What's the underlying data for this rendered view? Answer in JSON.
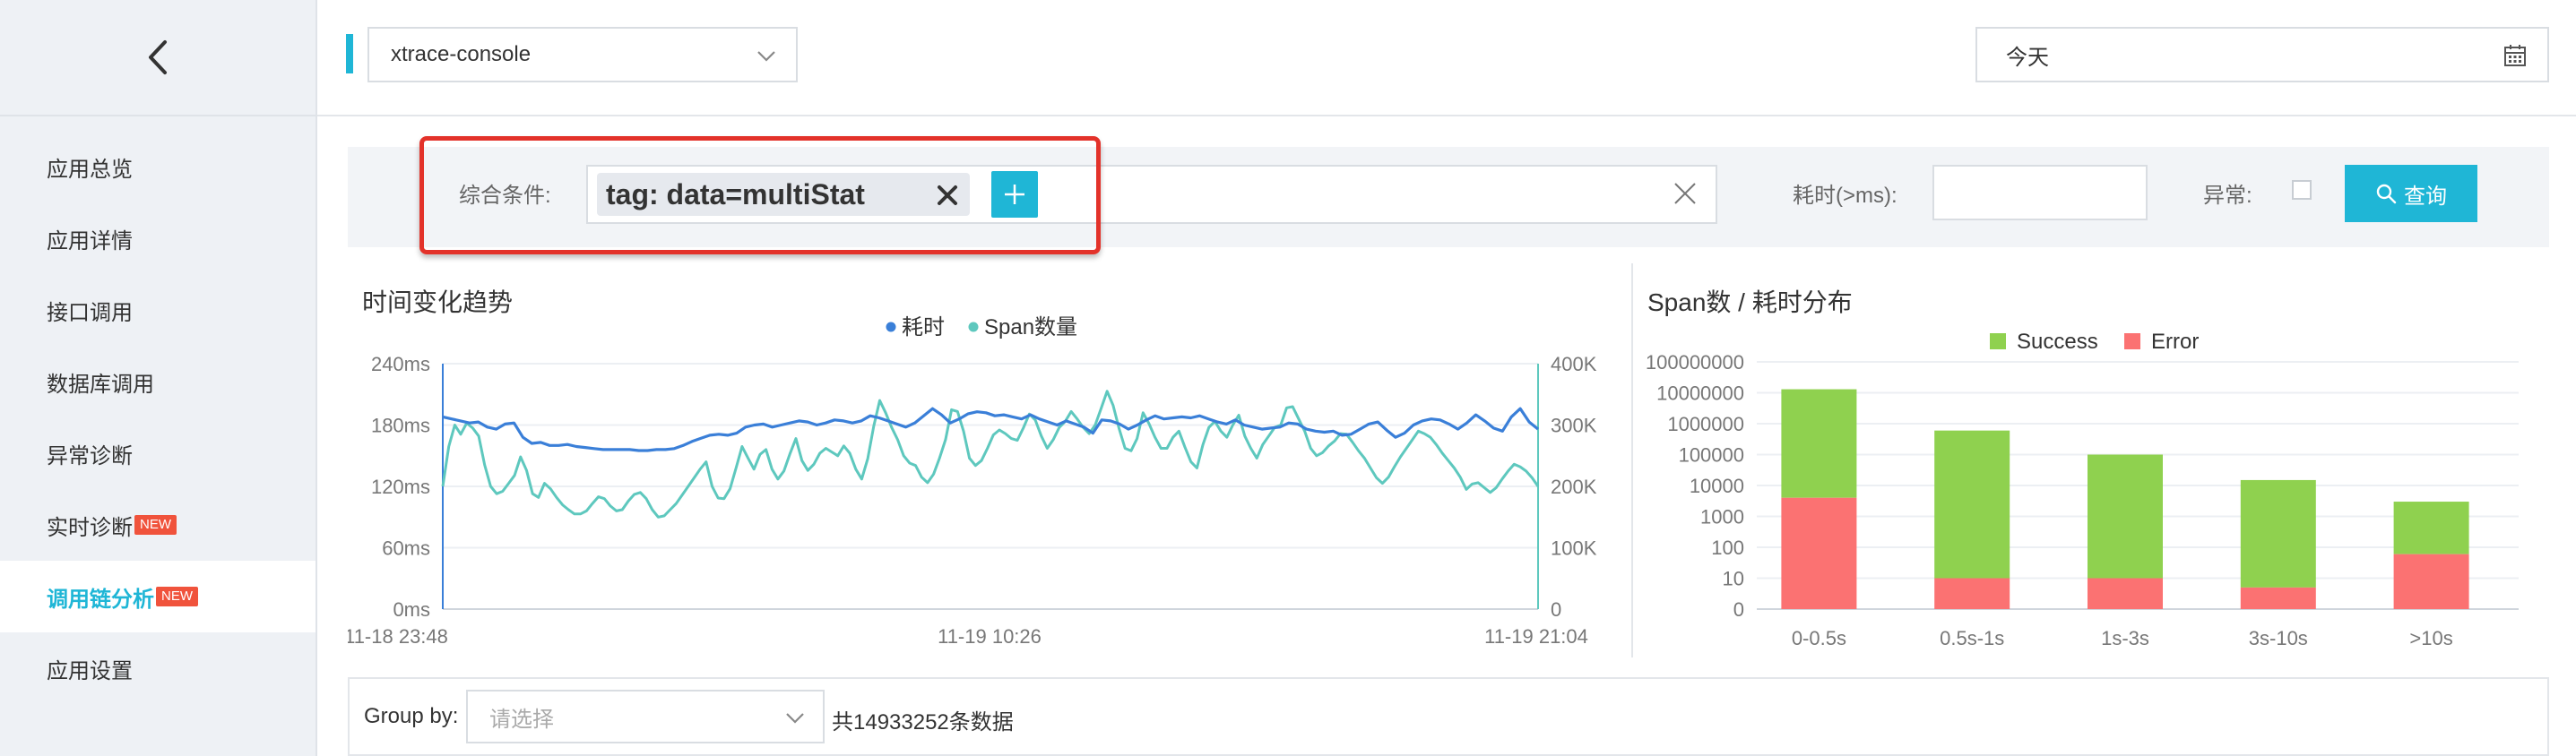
{
  "sidebar": {
    "items": [
      {
        "label": "应用总览",
        "new": false,
        "active": false
      },
      {
        "label": "应用详情",
        "new": false,
        "active": false
      },
      {
        "label": "接口调用",
        "new": false,
        "active": false
      },
      {
        "label": "数据库调用",
        "new": false,
        "active": false
      },
      {
        "label": "异常诊断",
        "new": false,
        "active": false
      },
      {
        "label": "实时诊断",
        "new": true,
        "active": false
      },
      {
        "label": "调用链分析",
        "new": true,
        "active": true
      },
      {
        "label": "应用设置",
        "new": false,
        "active": false
      }
    ],
    "new_badge": "NEW"
  },
  "topbar": {
    "app_select_value": "xtrace-console",
    "date_value": "今天"
  },
  "filter": {
    "condition_label": "综合条件:",
    "tag_chip": "tag: data=multiStat",
    "duration_label": "耗时(>ms):",
    "error_label": "异常:",
    "query_button": "查询",
    "duration_value": ""
  },
  "colors": {
    "accent": "#1fb6d6",
    "duration_line": "#3a7fd8",
    "span_line": "#5ec8be",
    "success": "#8fd14f",
    "error": "#fb7272",
    "highlight": "#e3322a",
    "badge": "#f0533c"
  },
  "timeseries_chart": {
    "title": "时间变化趋势",
    "legend": [
      {
        "name": "耗时"
      },
      {
        "name": "Span数量"
      }
    ],
    "y_left_ticks": [
      "240ms",
      "180ms",
      "120ms",
      "60ms",
      "0ms"
    ],
    "y_right_ticks": [
      "400K",
      "300K",
      "200K",
      "100K",
      "0"
    ],
    "x_ticks": [
      "11-18 23:48",
      "11-19 10:26",
      "11-19 21:04"
    ]
  },
  "bar_chart": {
    "title": "Span数 / 耗时分布",
    "legend": [
      {
        "name": "Success"
      },
      {
        "name": "Error"
      }
    ],
    "y_ticks": [
      "100000000",
      "10000000",
      "1000000",
      "100000",
      "10000",
      "1000",
      "100",
      "10",
      "0"
    ],
    "categories": [
      "0-0.5s",
      "0.5s-1s",
      "1s-3s",
      "3s-10s",
      ">10s"
    ]
  },
  "chart_data": [
    {
      "type": "line",
      "title": "时间变化趋势",
      "xlabel": "",
      "ylabel": "",
      "x_range": [
        "11-18 23:48",
        "11-19 21:04"
      ],
      "ylim_left": [
        0,
        240
      ],
      "ylim_right": [
        0,
        400000
      ],
      "grid": true,
      "legend_position": "top-center",
      "series": [
        {
          "name": "耗时",
          "axis": "left",
          "values": [
            188,
            186,
            184,
            182,
            183,
            178,
            176,
            181,
            182,
            168,
            162,
            163,
            160,
            160,
            161,
            159,
            158,
            157,
            156,
            156,
            156,
            156,
            155,
            155,
            156,
            156,
            157,
            160,
            164,
            167,
            170,
            171,
            170,
            172,
            178,
            180,
            181,
            178,
            180,
            182,
            184,
            183,
            180,
            182,
            185,
            184,
            182,
            184,
            189,
            187,
            184,
            181,
            178,
            182,
            189,
            196,
            190,
            182,
            186,
            191,
            193,
            192,
            189,
            190,
            188,
            186,
            190,
            186,
            183,
            180,
            184,
            181,
            178,
            172,
            185,
            184,
            181,
            176,
            180,
            185,
            189,
            186,
            187,
            188,
            187,
            189,
            186,
            183,
            181,
            185,
            180,
            178,
            176,
            177,
            178,
            182,
            181,
            176,
            174,
            173,
            174,
            170,
            171,
            176,
            181,
            183,
            175,
            168,
            172,
            180,
            184,
            186,
            185,
            181,
            176,
            182,
            190,
            184,
            177,
            174,
            188,
            196,
            183,
            176
          ]
        },
        {
          "name": "Span数量",
          "axis": "right",
          "values": [
            200000,
            265000,
            300000,
            285000,
            303000,
            295000,
            282000,
            235000,
            200000,
            188000,
            192000,
            205000,
            218000,
            248000,
            226000,
            188000,
            182000,
            205000,
            196000,
            182000,
            170000,
            162000,
            155000,
            155000,
            160000,
            172000,
            183000,
            180000,
            168000,
            160000,
            162000,
            176000,
            187000,
            190000,
            180000,
            162000,
            150000,
            152000,
            162000,
            172000,
            186000,
            200000,
            214000,
            228000,
            240000,
            200000,
            181000,
            180000,
            196000,
            230000,
            265000,
            246000,
            228000,
            252000,
            260000,
            228000,
            212000,
            225000,
            253000,
            278000,
            242000,
            226000,
            236000,
            254000,
            262000,
            256000,
            250000,
            266000,
            254000,
            228000,
            212000,
            245000,
            298000,
            340000,
            320000,
            296000,
            276000,
            250000,
            238000,
            234000,
            215000,
            206000,
            220000,
            246000,
            276000,
            325000,
            322000,
            290000,
            246000,
            234000,
            242000,
            262000,
            284000,
            292000,
            286000,
            278000,
            275000,
            295000,
            318000,
            308000,
            282000,
            262000,
            276000,
            296000,
            306000,
            322000,
            310000,
            296000,
            286000,
            300000,
            327000,
            355000,
            332000,
            294000,
            262000,
            258000,
            278000,
            320000,
            302000,
            280000,
            262000,
            262000,
            280000,
            290000,
            264000,
            240000,
            230000,
            268000,
            296000,
            306000,
            290000,
            280000,
            300000,
            316000,
            282000,
            262000,
            246000,
            268000,
            282000,
            296000,
            300000,
            328000,
            330000,
            310000,
            290000,
            262000,
            250000,
            255000,
            266000,
            274000,
            286000,
            285000,
            272000,
            258000,
            246000,
            230000,
            214000,
            205000,
            215000,
            232000,
            248000,
            262000,
            276000,
            290000,
            286000,
            280000,
            268000,
            254000,
            242000,
            230000,
            215000,
            195000,
            204000,
            206000,
            198000,
            190000,
            198000,
            212000,
            225000,
            236000,
            232000,
            225000,
            214000,
            200000
          ]
        }
      ]
    },
    {
      "type": "bar",
      "title": "Span数 / 耗时分布",
      "xlabel": "",
      "ylabel": "",
      "y_scale": "log",
      "ylim": [
        0,
        100000000
      ],
      "grid": true,
      "legend_position": "top-center",
      "stacked": true,
      "categories": [
        "0-0.5s",
        "0.5s-1s",
        "1s-3s",
        "3s-10s",
        ">10s"
      ],
      "series": [
        {
          "name": "Success",
          "values": [
            13000000,
            600000,
            100000,
            15000,
            3000
          ]
        },
        {
          "name": "Error",
          "values": [
            4000,
            10,
            10,
            5,
            60
          ]
        }
      ]
    }
  ],
  "groupby": {
    "label": "Group by:",
    "placeholder": "请选择",
    "count_text": "共14933252条数据"
  }
}
